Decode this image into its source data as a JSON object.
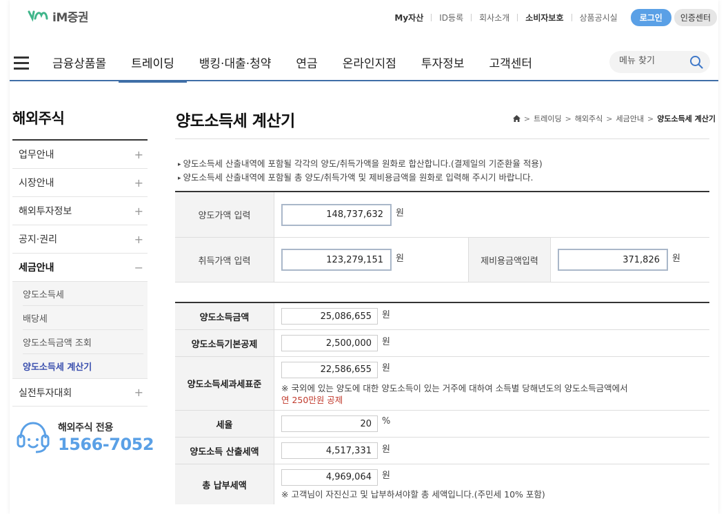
{
  "brand": {
    "name": "iM증권"
  },
  "util_links": [
    "My자산",
    "ID등록",
    "회사소개",
    "소비자보호",
    "상품공시실"
  ],
  "login_label": "로그인",
  "cert_label": "인증센터",
  "gnb": {
    "items": [
      "금융상품몰",
      "트레이딩",
      "뱅킹·대출·청약",
      "연금",
      "온라인지점",
      "투자정보",
      "고객센터"
    ],
    "active": "트레이딩",
    "search_placeholder": "메뉴 찾기"
  },
  "lnb": {
    "title": "해외주식",
    "items": [
      "업무안내",
      "시장안내",
      "해외투자정보",
      "공지·권리",
      "세금안내",
      "실전투자대회"
    ],
    "sub_items": [
      "양도소득세",
      "배당세",
      "양도소득금액 조회",
      "양도소득세 계산기"
    ],
    "toggle_closed": "+",
    "toggle_open": "−",
    "cs_label": "해외주식 전용",
    "cs_phone": "1566-7052"
  },
  "page": {
    "title": "양도소득세 계산기",
    "breadcrumb": [
      "트레이딩",
      "해외주식",
      "세금안내",
      "양도소득세 계산기"
    ],
    "breadcrumb_sep": ">",
    "notes": [
      "양도소득세 산출내역에 포함될 각각의 양도/취득가액을 원화로 합산합니다.(결제일의 기준환율 적용)",
      "양도소득세 산출내역에 포함될 총 양도/취득가액 및 제비용금액을 원화로 입력해 주시기 바랍니다."
    ]
  },
  "input_form": {
    "sale_label": "양도가액 입력",
    "sale_value": "148,737,632",
    "acq_label": "취득가액 입력",
    "acq_value": "123,279,151",
    "exp_label": "제비용금액입력",
    "exp_value": "371,826",
    "unit": "원"
  },
  "result": {
    "gain_label": "양도소득금액",
    "gain_value": "25,086,655",
    "deduct_label": "양도소득기본공제",
    "deduct_value": "2,500,000",
    "base_label": "양도소득세과세표준",
    "base_value": "22,586,655",
    "base_note": "※ 국외에 있는 양도에 대한 양도소득이 있는 거주에 대하여 소득별 당해년도의 양도소득금액에서",
    "base_note_red": "연 250만원 공제",
    "rate_label": "세율",
    "rate_value": "20",
    "rate_unit": "%",
    "tax_label": "양도소득 산출세액",
    "tax_value": "4,517,331",
    "total_label": "총 납부세액",
    "total_value": "4,969,064",
    "total_note": "※ 고객님이 자진신고 및 납부하셔야할 총 세액입니다.(주민세 10% 포함)",
    "unit": "원"
  }
}
